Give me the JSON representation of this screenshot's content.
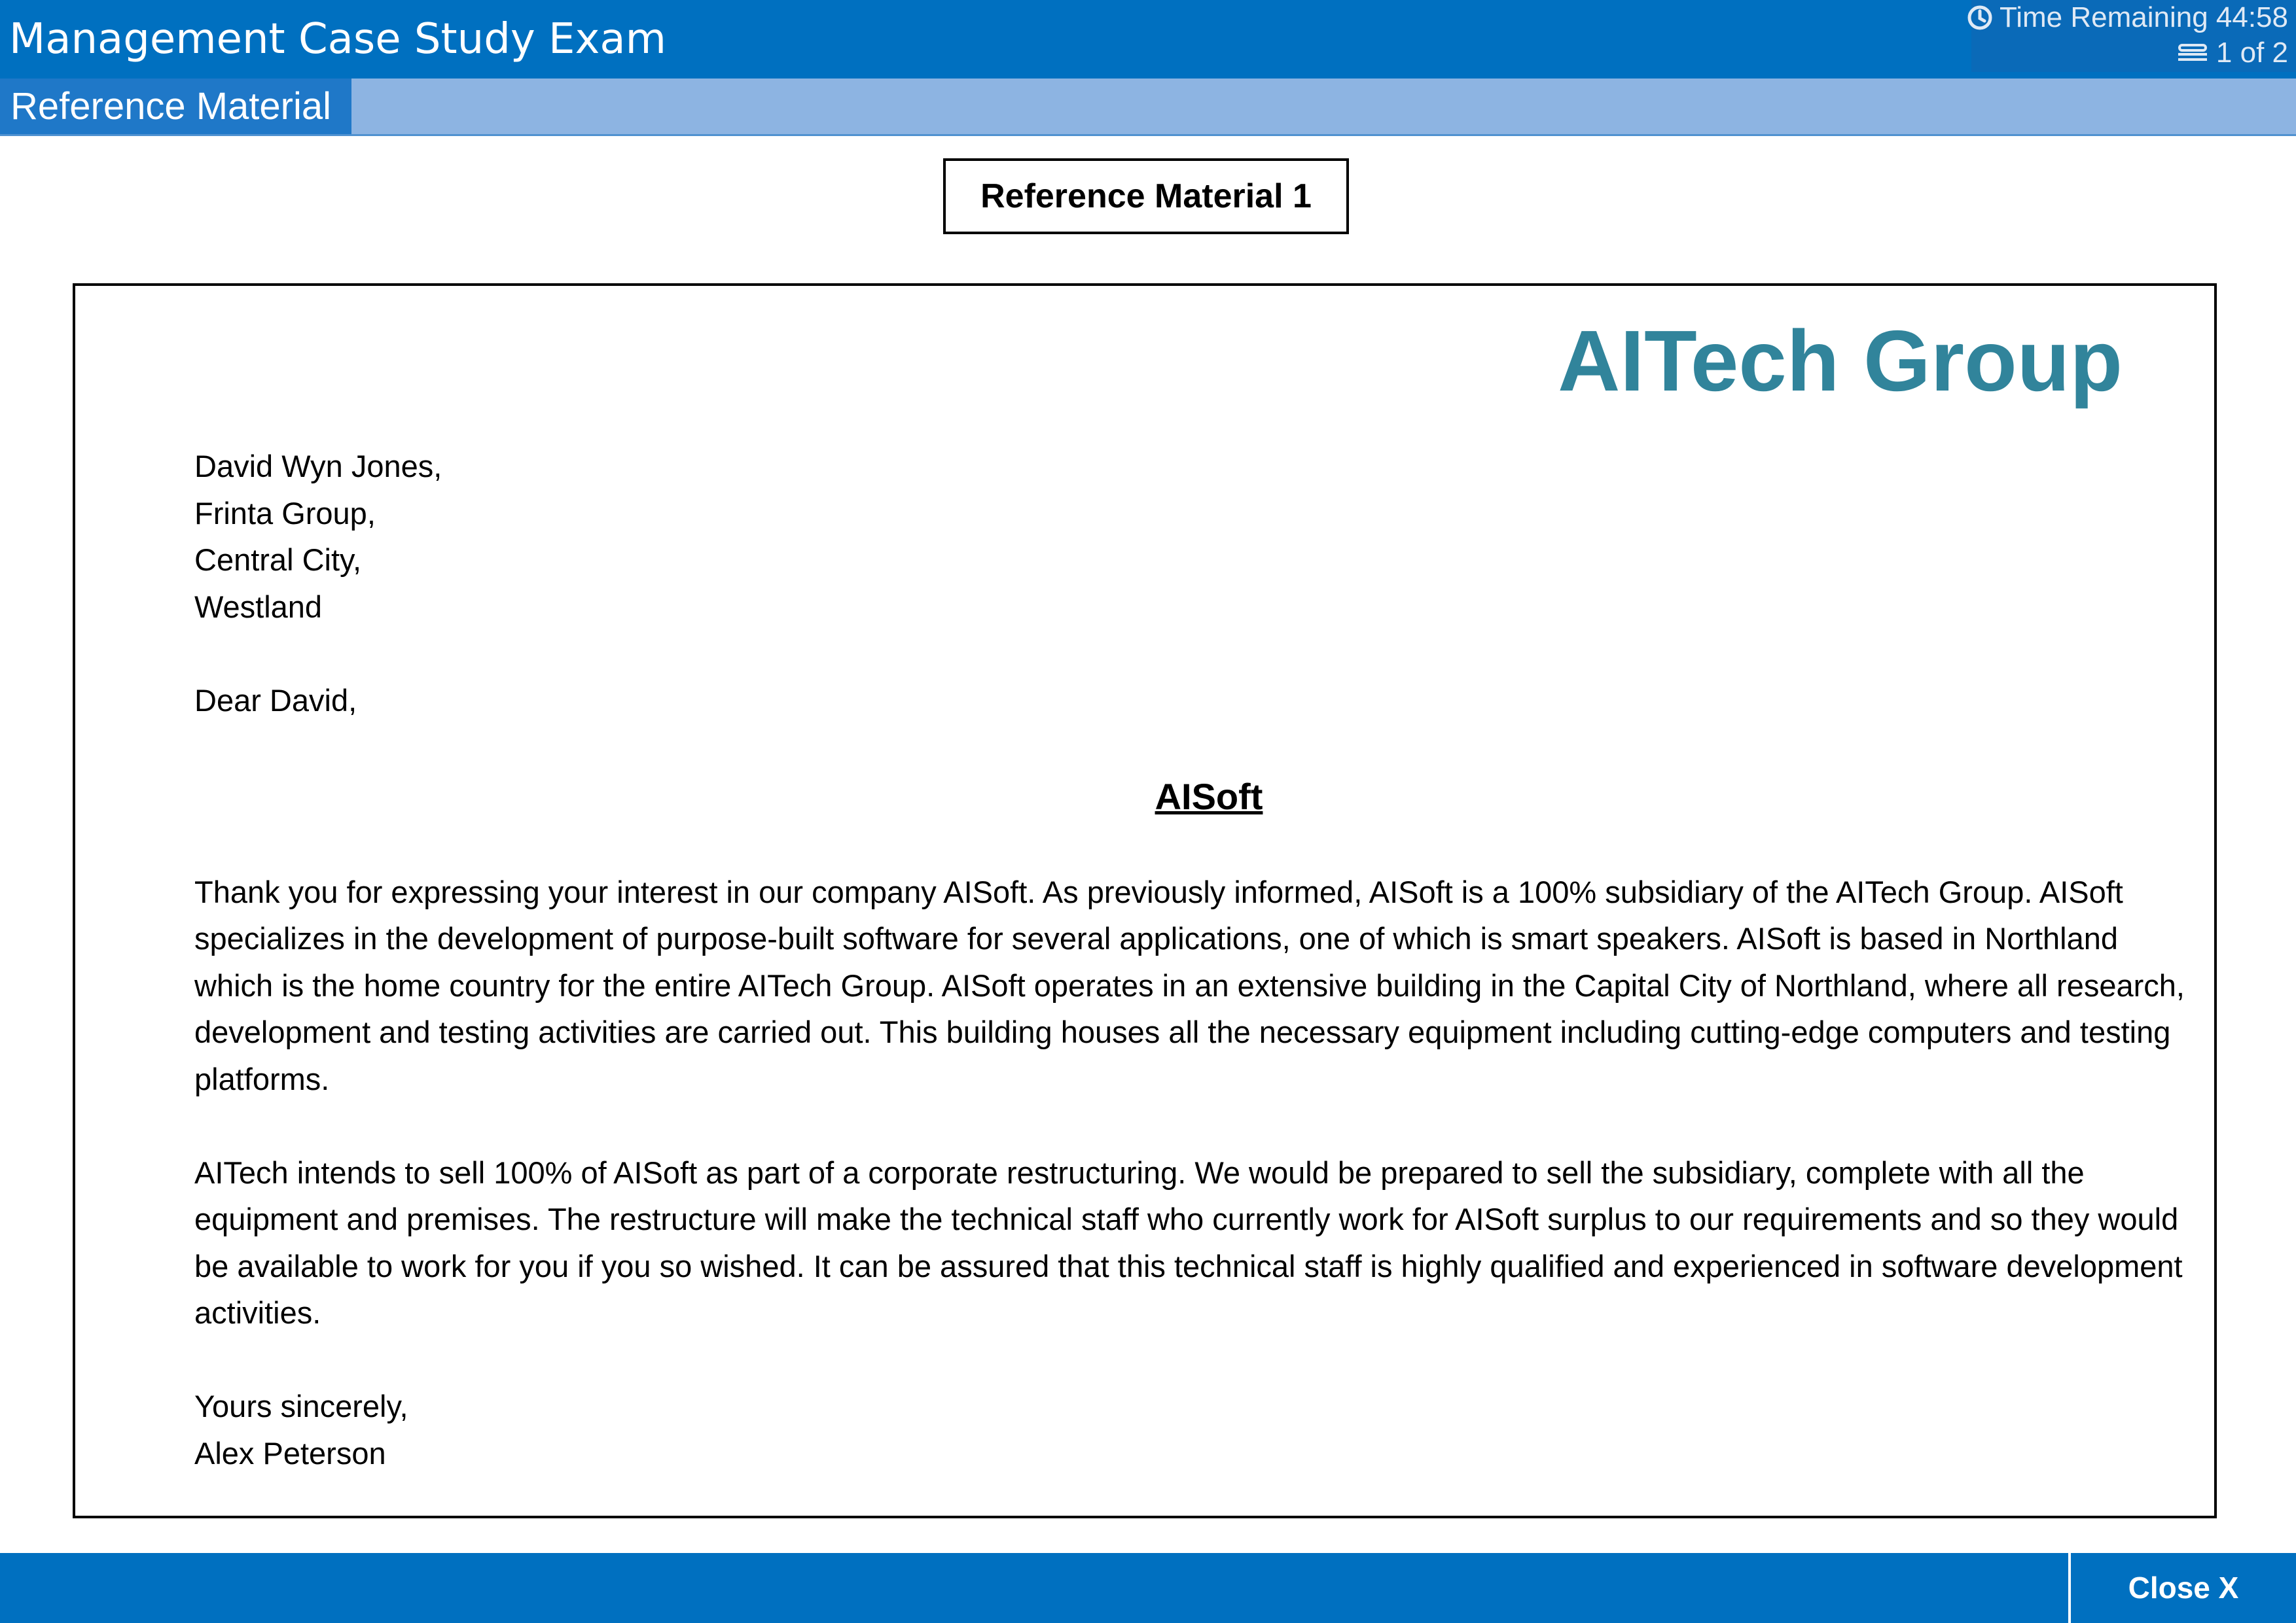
{
  "header": {
    "title": "Management Case Study Exam",
    "time_remaining": "Time Remaining 44:58",
    "page_indicator": "1 of 2",
    "time_icon": "clock-icon",
    "page_icon": "pages-icon"
  },
  "subheader": {
    "tab_label": "Reference Material"
  },
  "reference": {
    "title": "Reference Material 1"
  },
  "letter": {
    "brand": "AITech Group",
    "address": [
      "David Wyn Jones,",
      "Frinta Group,",
      "Central City,",
      "Westland"
    ],
    "salutation": "Dear David,",
    "subject": "AISoft",
    "paragraphs": [
      "Thank you for expressing your interest in our company AISoft. As previously informed, AISoft is a 100% subsidiary of the AITech Group. AISoft specializes in the development of purpose-built software for several applications, one of which is smart speakers. AISoft is based in Northland which is the home country for the entire AITech Group. AISoft operates in an extensive building in the Capital City of Northland, where all research, development and testing activities are carried out. This building houses all the necessary equipment including cutting-edge computers and testing platforms.",
      "AITech intends to sell 100% of AISoft as part of a corporate restructuring. We would be prepared to sell the subsidiary, complete with all the equipment and premises. The restructure will make the technical staff who currently work for AISoft surplus to our requirements and so they would be available to work for you if you so wished. It can be assured that this technical staff is highly qualified and experienced in software development activities."
    ],
    "closing": "Yours sincerely,",
    "signature": "Alex Peterson"
  },
  "footer": {
    "close_label": "Close X"
  },
  "colors": {
    "header_blue": "#0070c0",
    "subbar_blue": "#8db4e2",
    "brand_teal": "#31849b"
  }
}
